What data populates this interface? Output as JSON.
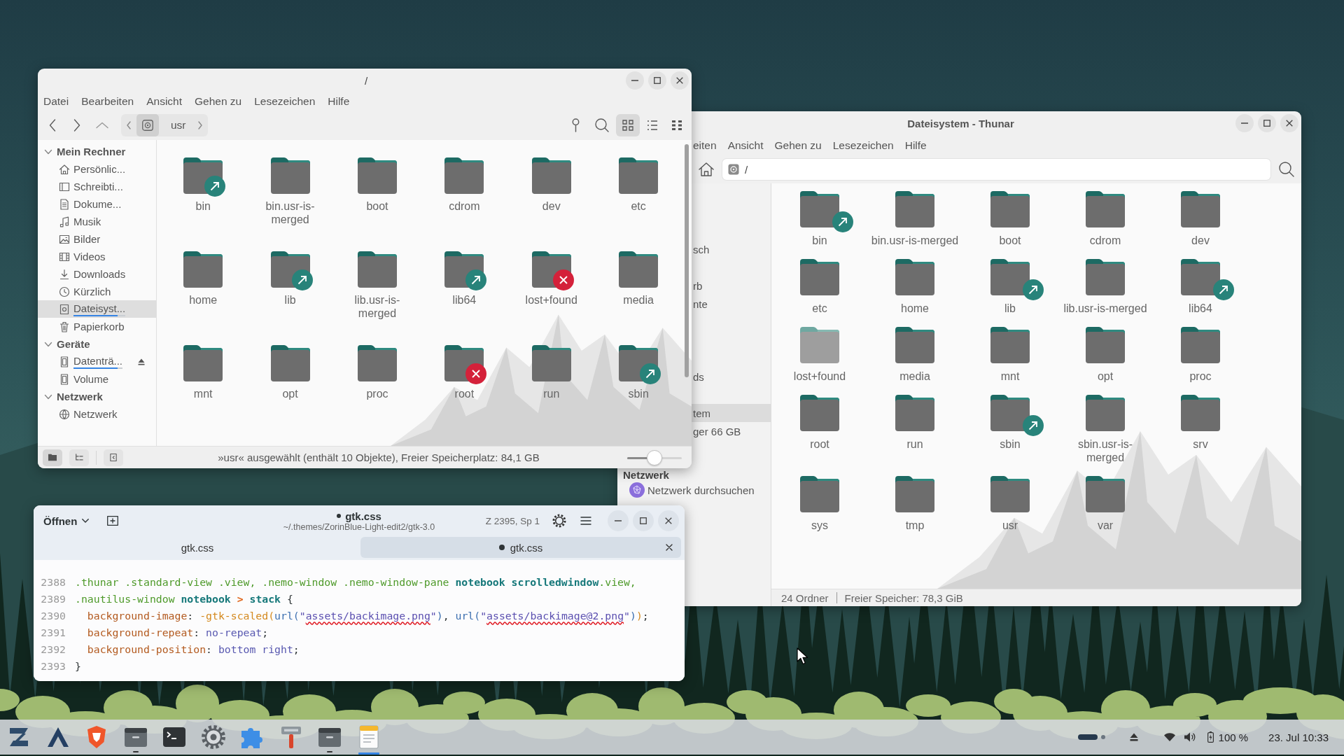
{
  "file_manager": {
    "title": "/",
    "menu": [
      "Datei",
      "Bearbeiten",
      "Ansicht",
      "Gehen zu",
      "Lesezeichen",
      "Hilfe"
    ],
    "path": [
      {
        "kind": "drive",
        "selected": true
      },
      {
        "kind": "folder",
        "label": "usr",
        "selected": false
      }
    ],
    "view_modes": [
      {
        "kind": "grid",
        "selected": true
      },
      {
        "kind": "list",
        "selected": false
      },
      {
        "kind": "compact",
        "selected": false
      }
    ],
    "sidebar": [
      {
        "heading": "Mein Rechner",
        "expanded": true,
        "items": [
          {
            "label": "Persönlic...",
            "kind": "home",
            "selected": false,
            "eject": false
          },
          {
            "label": "Schreibti...",
            "kind": "desktop",
            "selected": false,
            "eject": false
          },
          {
            "label": "Dokume...",
            "kind": "document",
            "selected": false,
            "eject": false
          },
          {
            "label": "Musik",
            "kind": "music",
            "selected": false,
            "eject": false
          },
          {
            "label": "Bilder",
            "kind": "pictures",
            "selected": false,
            "eject": false
          },
          {
            "label": "Videos",
            "kind": "videos",
            "selected": false,
            "eject": false
          },
          {
            "label": "Downloads",
            "kind": "downloads",
            "selected": false,
            "eject": false
          },
          {
            "label": "Kürzlich",
            "kind": "recent",
            "selected": false,
            "eject": false
          },
          {
            "label": "Dateisyst...",
            "kind": "filesystem",
            "selected": true,
            "eject": false,
            "level": 0.85
          },
          {
            "label": "Papierkorb",
            "kind": "trash",
            "selected": false,
            "eject": false
          }
        ]
      },
      {
        "heading": "Geräte",
        "expanded": true,
        "items": [
          {
            "label": "Datenträ...",
            "kind": "disk",
            "selected": false,
            "eject": true,
            "level": 0.9
          },
          {
            "label": "Volume",
            "kind": "disk",
            "selected": false,
            "eject": false
          }
        ]
      },
      {
        "heading": "Netzwerk",
        "expanded": true,
        "items": [
          {
            "label": "Netzwerk",
            "kind": "network",
            "selected": false,
            "eject": false
          }
        ]
      }
    ],
    "items": [
      {
        "name": "bin",
        "kind": "link"
      },
      {
        "name": "bin.usr-is-merged",
        "kind": "folder"
      },
      {
        "name": "boot",
        "kind": "folder"
      },
      {
        "name": "cdrom",
        "kind": "folder"
      },
      {
        "name": "dev",
        "kind": "folder"
      },
      {
        "name": "etc",
        "kind": "folder"
      },
      {
        "name": "home",
        "kind": "folder"
      },
      {
        "name": "lib",
        "kind": "link"
      },
      {
        "name": "lib.usr-is-merged",
        "kind": "folder"
      },
      {
        "name": "lib64",
        "kind": "link"
      },
      {
        "name": "lost+found",
        "kind": "unreadable"
      },
      {
        "name": "media",
        "kind": "folder"
      },
      {
        "name": "mnt",
        "kind": "folder"
      },
      {
        "name": "opt",
        "kind": "folder"
      },
      {
        "name": "proc",
        "kind": "folder"
      },
      {
        "name": "root",
        "kind": "unreadable"
      },
      {
        "name": "run",
        "kind": "folder"
      },
      {
        "name": "sbin",
        "kind": "link"
      }
    ],
    "status": "»usr« ausgewählt (enthält 10 Objekte), Freier Speicherplatz: 84,1 GB",
    "zoom": {
      "level": 0.5
    }
  },
  "thunar": {
    "title": "Dateisystem - Thunar",
    "menu": [
      "eiten",
      "Ansicht",
      "Gehen zu",
      "Lesezeichen",
      "Hilfe"
    ],
    "location": "/",
    "sidebar": [
      {
        "label": "sch",
        "selected": false
      },
      {
        "label": "rb",
        "selected": false
      },
      {
        "label": "nte",
        "selected": false
      },
      {
        "label": "ds",
        "selected": false
      },
      {
        "label": "tem",
        "selected": true
      },
      {
        "label": "ger 66 GB",
        "selected": false
      }
    ],
    "network": {
      "heading": "Netzwerk",
      "items": [
        {
          "label": "Netzwerk durchsuchen",
          "selected": false
        }
      ]
    },
    "items": [
      {
        "name": "bin",
        "kind": "link"
      },
      {
        "name": "bin.usr-is-merged",
        "kind": "folder"
      },
      {
        "name": "boot",
        "kind": "folder"
      },
      {
        "name": "cdrom",
        "kind": "folder"
      },
      {
        "name": "dev",
        "kind": "folder"
      },
      {
        "name": "etc",
        "kind": "folder"
      },
      {
        "name": "home",
        "kind": "folder"
      },
      {
        "name": "lib",
        "kind": "link"
      },
      {
        "name": "lib.usr-is-merged",
        "kind": "folder"
      },
      {
        "name": "lib64",
        "kind": "link"
      },
      {
        "name": "lost+found",
        "kind": "unreadable"
      },
      {
        "name": "media",
        "kind": "folder"
      },
      {
        "name": "mnt",
        "kind": "folder"
      },
      {
        "name": "opt",
        "kind": "folder"
      },
      {
        "name": "proc",
        "kind": "folder"
      },
      {
        "name": "root",
        "kind": "folder"
      },
      {
        "name": "run",
        "kind": "folder"
      },
      {
        "name": "sbin",
        "kind": "link"
      },
      {
        "name": "sbin.usr-is-merged",
        "kind": "folder"
      },
      {
        "name": "srv",
        "kind": "folder"
      },
      {
        "name": "sys",
        "kind": "folder"
      },
      {
        "name": "tmp",
        "kind": "folder"
      },
      {
        "name": "usr",
        "kind": "folder"
      },
      {
        "name": "var",
        "kind": "folder"
      }
    ],
    "status": [
      "24 Ordner",
      "Freier Speicher: 78,3 GiB"
    ]
  },
  "editor": {
    "open_button": "Öffnen",
    "title": "gtk.css",
    "modified": true,
    "path": "~/.themes/ZorinBlue-Light-edit2/gtk-3.0",
    "position": "Z 2395, Sp 1",
    "tabs": [
      {
        "label": "gtk.css",
        "modified": false,
        "selected": false
      },
      {
        "label": "gtk.css",
        "modified": true,
        "selected": true
      }
    ],
    "lines": [
      {
        "number": "2388",
        "kind": "rule",
        "tokens": [
          {
            "text": ".thunar .standard-view .view, .nemo-window .nemo-window-pane ",
            "kind": "selector"
          },
          {
            "text": "notebook scrolledwindow",
            "kind": "keyword"
          },
          {
            "text": ".view,",
            "kind": "selector"
          }
        ]
      },
      {
        "number": "2389",
        "kind": "rule",
        "tokens": [
          {
            "text": ".nautilus-window ",
            "kind": "selector"
          },
          {
            "text": "notebook ",
            "kind": "keyword"
          },
          {
            "text": "> ",
            "kind": "operator"
          },
          {
            "text": "stack ",
            "kind": "keyword"
          },
          {
            "text": "{",
            "kind": "punct"
          }
        ]
      },
      {
        "number": "2390",
        "kind": "declaration",
        "tokens": [
          {
            "text": "background-image",
            "kind": "property"
          },
          {
            "text": ": ",
            "kind": "punct"
          },
          {
            "text": "-gtk-scaled(",
            "kind": "function"
          },
          {
            "text": "url(",
            "kind": "url"
          },
          {
            "text": "\"",
            "kind": "string"
          },
          {
            "text": "assets/backimage.png",
            "kind": "flagged"
          },
          {
            "text": "\"",
            "kind": "string"
          },
          {
            "text": ")",
            "kind": "url"
          },
          {
            "text": ", ",
            "kind": "punct"
          },
          {
            "text": "url(",
            "kind": "url"
          },
          {
            "text": "\"",
            "kind": "string"
          },
          {
            "text": "assets/backimage@2.png",
            "kind": "flagged"
          },
          {
            "text": "\"",
            "kind": "string"
          },
          {
            "text": ")",
            "kind": "url"
          },
          {
            "text": ")",
            "kind": "function"
          },
          {
            "text": ";",
            "kind": "punct"
          }
        ]
      },
      {
        "number": "2391",
        "kind": "declaration",
        "tokens": [
          {
            "text": "background-repeat",
            "kind": "property"
          },
          {
            "text": ": ",
            "kind": "punct"
          },
          {
            "text": "no-repeat",
            "kind": "value"
          },
          {
            "text": ";",
            "kind": "punct"
          }
        ]
      },
      {
        "number": "2392",
        "kind": "declaration",
        "tokens": [
          {
            "text": "background-position",
            "kind": "property"
          },
          {
            "text": ": ",
            "kind": "punct"
          },
          {
            "text": "bottom right",
            "kind": "value"
          },
          {
            "text": ";",
            "kind": "punct"
          }
        ]
      },
      {
        "number": "2393",
        "kind": "rule",
        "tokens": [
          {
            "text": "}",
            "kind": "punct"
          }
        ]
      }
    ]
  },
  "taskbar": {
    "apps": [
      {
        "kind": "zorin",
        "running": false,
        "selected": false
      },
      {
        "kind": "triangle",
        "running": false,
        "selected": false
      },
      {
        "kind": "shield",
        "running": false,
        "selected": false
      },
      {
        "kind": "files",
        "running": true,
        "selected": false
      },
      {
        "kind": "terminal",
        "running": false,
        "selected": false
      },
      {
        "kind": "settings",
        "running": false,
        "selected": false
      },
      {
        "kind": "puzzle",
        "running": false,
        "selected": false
      },
      {
        "kind": "stamp",
        "running": false,
        "selected": false
      },
      {
        "kind": "files",
        "running": true,
        "selected": false
      },
      {
        "kind": "notes",
        "running": true,
        "selected": true
      }
    ],
    "battery": "100 %",
    "clock": "23. Jul 10:33"
  }
}
